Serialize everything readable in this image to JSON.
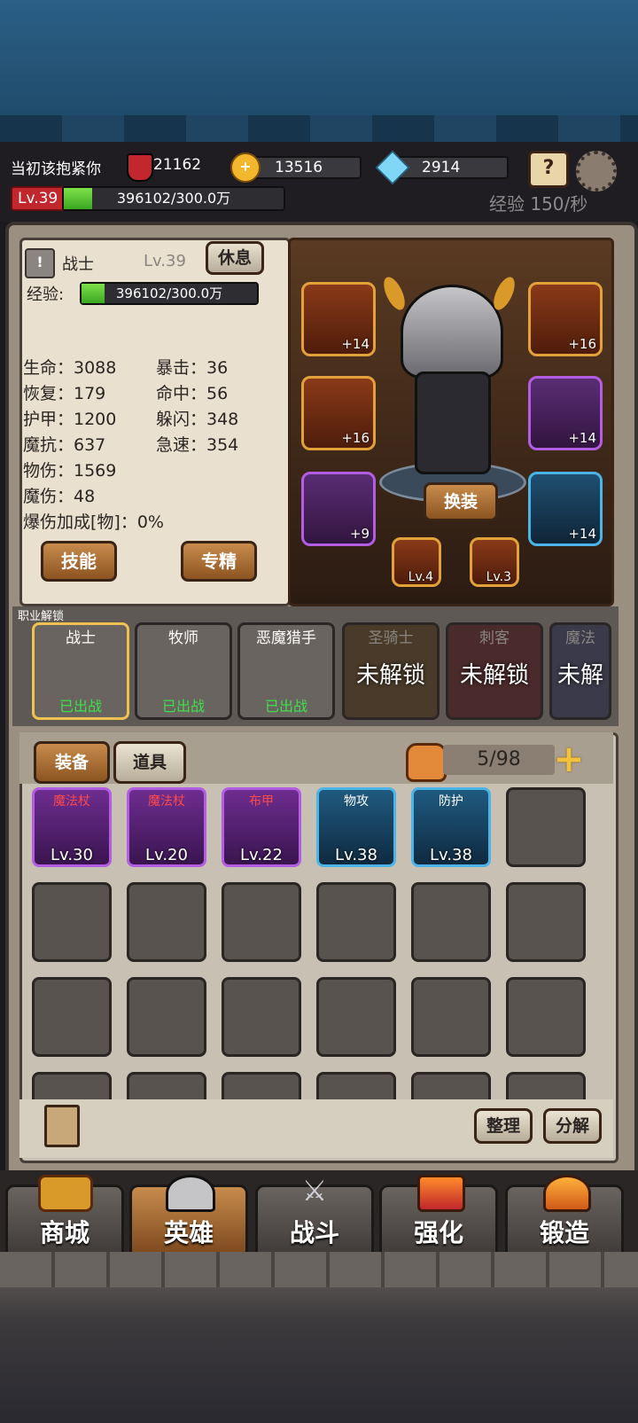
{
  "player": {
    "name": "当初该抱紧你",
    "power": "21162",
    "gold": "13516",
    "diamonds": "2914",
    "level": "Lv.39",
    "xp": "396102/300.0万",
    "xp_fraction": 0.13,
    "xp_rate": "经验 150/秒"
  },
  "hero": {
    "class": "战士",
    "level": "Lv.39",
    "rest_label": "休息",
    "xp_label": "经验:",
    "xp": "396102/300.0万",
    "stats_left": [
      "生命：3088",
      "恢复：179",
      "护甲：1200",
      "魔抗：637",
      "物伤：1569",
      "魔伤：48",
      "爆伤加成[物]：0%"
    ],
    "stats_right": [
      "暴击：36",
      "命中：56",
      "躲闪：348",
      "急速：354"
    ],
    "skill_label": "技能",
    "mastery_label": "专精",
    "change_label": "换装"
  },
  "equipment": {
    "helmet": "+14",
    "amulet": "+16",
    "armor": "+16",
    "weapon": "+14",
    "boots": "+9",
    "ring": "+14",
    "gem1": "Lv.4",
    "gem2": "Lv.3"
  },
  "class_section": {
    "title": "职业解锁",
    "classes": [
      {
        "name": "战士",
        "status": "已出战"
      },
      {
        "name": "牧师",
        "status": "已出战"
      },
      {
        "name": "恶魔猎手",
        "status": "已出战"
      },
      {
        "name": "圣骑士",
        "status": "未解锁"
      },
      {
        "name": "刺客",
        "status": "未解锁"
      },
      {
        "name": "魔法",
        "status": "未解"
      }
    ]
  },
  "inventory": {
    "tab_equip": "装备",
    "tab_items": "道具",
    "capacity": "5/98",
    "sort_label": "整理",
    "decompose_label": "分解",
    "items": [
      {
        "type": "魔法杖",
        "level": "Lv.30"
      },
      {
        "type": "魔法杖",
        "level": "Lv.20"
      },
      {
        "type": "布甲",
        "level": "Lv.22"
      },
      {
        "type": "物攻",
        "level": "Lv.38"
      },
      {
        "type": "防护",
        "level": "Lv.38"
      }
    ]
  },
  "nav": {
    "shop": "商城",
    "hero": "英雄",
    "battle": "战斗",
    "enhance": "强化",
    "forge": "锻造"
  },
  "colors": {
    "xp_green": "#5cc63a",
    "level_red": "#c1272d",
    "accent_gold": "#e3a13a"
  }
}
